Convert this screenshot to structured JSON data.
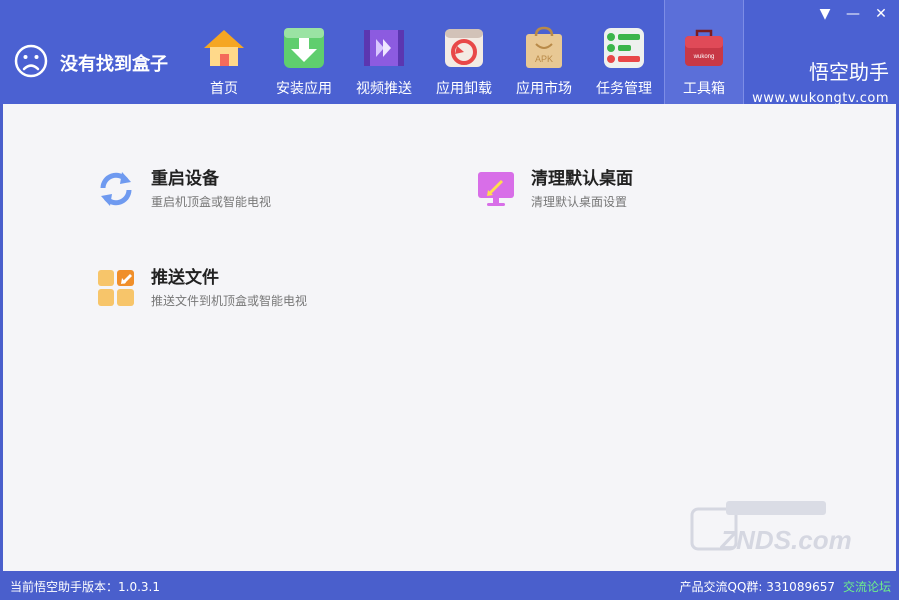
{
  "window_controls": {
    "menu": "▼",
    "minimize": "—",
    "close": "✕"
  },
  "device": {
    "status": "没有找到盒子"
  },
  "nav": {
    "items": [
      {
        "label": "首页",
        "icon": "home-icon"
      },
      {
        "label": "安装应用",
        "icon": "install-download-icon"
      },
      {
        "label": "视频推送",
        "icon": "video-push-icon"
      },
      {
        "label": "应用卸载",
        "icon": "app-uninstall-icon"
      },
      {
        "label": "应用市场",
        "icon": "apk-market-bag-icon"
      },
      {
        "label": "任务管理",
        "icon": "task-manager-icon"
      },
      {
        "label": "工具箱",
        "icon": "toolbox-icon",
        "active": true
      }
    ],
    "toolbox_badge": "wukong",
    "market_badge": "APK"
  },
  "brand": {
    "name": "悟空助手",
    "site": "www.wukongtv.com"
  },
  "tools": [
    {
      "title": "重启设备",
      "desc": "重启机顶盒或智能电视",
      "icon": "restart-refresh-icon"
    },
    {
      "title": "清理默认桌面",
      "desc": "清理默认桌面设置",
      "icon": "desktop-monitor-icon"
    },
    {
      "title": "推送文件",
      "desc": "推送文件到机顶盒或智能电视",
      "icon": "push-file-icon"
    }
  ],
  "watermark": "ZNDS.com",
  "status": {
    "version": "当前悟空助手版本：1.0.3.1",
    "qq": "产品交流QQ群: 331089657",
    "forum": "交流论坛"
  },
  "colors": {
    "header": "#4b61d2",
    "content_bg": "#f5f5f8",
    "forum_link": "#6ef08a"
  }
}
